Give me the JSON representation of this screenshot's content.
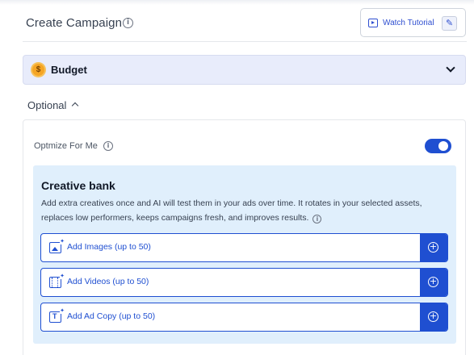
{
  "header": {
    "title": "Create Campaign",
    "watch_tutorial": "Watch Tutorial",
    "info_glyph": "i"
  },
  "budget": {
    "label": "Budget",
    "coin_glyph": "$"
  },
  "optional": {
    "label": "Optional"
  },
  "optimize": {
    "label": "Optmize For Me",
    "toggle_on": true
  },
  "creative_bank": {
    "title": "Creative bank",
    "description": "Add extra creatives once and AI will test them in your ads over time. It rotates in your selected assets, replaces low performers, keeps campaigns fresh, and improves results.",
    "rows": [
      {
        "label": "Add Images (up to 50)",
        "icon": "image-icon"
      },
      {
        "label": "Add Videos (up to 50)",
        "icon": "video-icon"
      },
      {
        "label": "Add Ad Copy (up to 50)",
        "icon": "text-icon"
      }
    ]
  },
  "colors": {
    "accent": "#1f4fd1",
    "budget_bg": "#e8ecfb",
    "creative_bg": "#e0effc",
    "coin": "#f5a524"
  },
  "icons": {
    "plus": "+",
    "sparkle": "✦",
    "text_glyph": "T"
  }
}
